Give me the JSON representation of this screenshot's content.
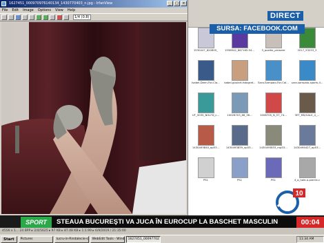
{
  "viewer": {
    "title": "1627451_000970976140134_1430770403_n.jpg - IrfanView",
    "menu": [
      "File",
      "Edit",
      "Image",
      "Options",
      "View",
      "Help"
    ],
    "zoom_value": "1/4 (0.8)",
    "window_buttons": [
      "_",
      "□",
      "×"
    ]
  },
  "explorer": {
    "thumbnails": [
      {
        "label": "1530447_620605_",
        "color": "#c8c8d8"
      },
      {
        "label": "1558542_867165.54...",
        "color": "#5a3aa0"
      },
      {
        "label": "3_pozitie_picioare",
        "color": "#c8c0b8"
      },
      {
        "label": "2017_53253_3",
        "color": "#3a8a3a"
      },
      {
        "label": "Isabel-Deen-For-Cla...",
        "color": "#3a5a8a"
      },
      {
        "label": "isabel-goulart-fotograf...",
        "color": "#c8a080"
      },
      {
        "label": "Sara-Sampaio-For-Cal...",
        "color": "#4a90c8"
      },
      {
        "label": "sara-sampaio-sports-il...",
        "color": "#3a8ac8"
      },
      {
        "label": "UT_5035_NOLFD_c...",
        "color": "#3a9a9a"
      },
      {
        "label": "10026703_66_36...",
        "color": "#7a9ab8"
      },
      {
        "label": "1006705_N_57_74...",
        "color": "#d04848"
      },
      {
        "label": "3ET_MS/GALE_4_...",
        "color": "#6a5a4a"
      },
      {
        "label": "1430493840_op53...",
        "color": "#b85a48"
      },
      {
        "label": "1430493839_up53...",
        "color": "#5a6a8a"
      },
      {
        "label": "1430493833_mp53...",
        "color": "#8a8a7a"
      },
      {
        "label": "1430494427_op53...",
        "color": "#6a7a9a"
      },
      {
        "label": "PS1",
        "color": "#d0d0d0"
      },
      {
        "label": "PS1",
        "color": "#8aa0c8"
      },
      {
        "label": "PS1",
        "color": "#6a6ab8"
      },
      {
        "label": "4_a_hale-a-pierrie-c",
        "color": "#a8a8a8"
      }
    ]
  },
  "overlay": {
    "direct": "DIRECT",
    "source": "SURSA: FACEBOOK.COM",
    "ticker_tag": "SPORT",
    "headline": "STEAUA BUCUREŞTI VA JUCA ÎN EUROCUP LA BASCHET MASCULIN",
    "clock": "00:04",
    "channel_number": "10",
    "brand_color": "#1b5fa8",
    "accent_green": "#2aa84a",
    "accent_red": "#d62828"
  },
  "status": {
    "text": "4556 x 1... 24 BPP  ▸ 2/4/5625  ▸ 97 KB  ▸ 87.48 KB  ▸ 1:1.99  ▸ 6/9/2019 / 21:35:00"
  },
  "taskbar": {
    "start": "Start",
    "tasks": [
      "Pictures",
      "lucru-in-Rindalecie-sap",
      "WebEdit Tools - Window",
      "1627451_0009770279"
    ],
    "tray_time": "11:34 AM"
  }
}
